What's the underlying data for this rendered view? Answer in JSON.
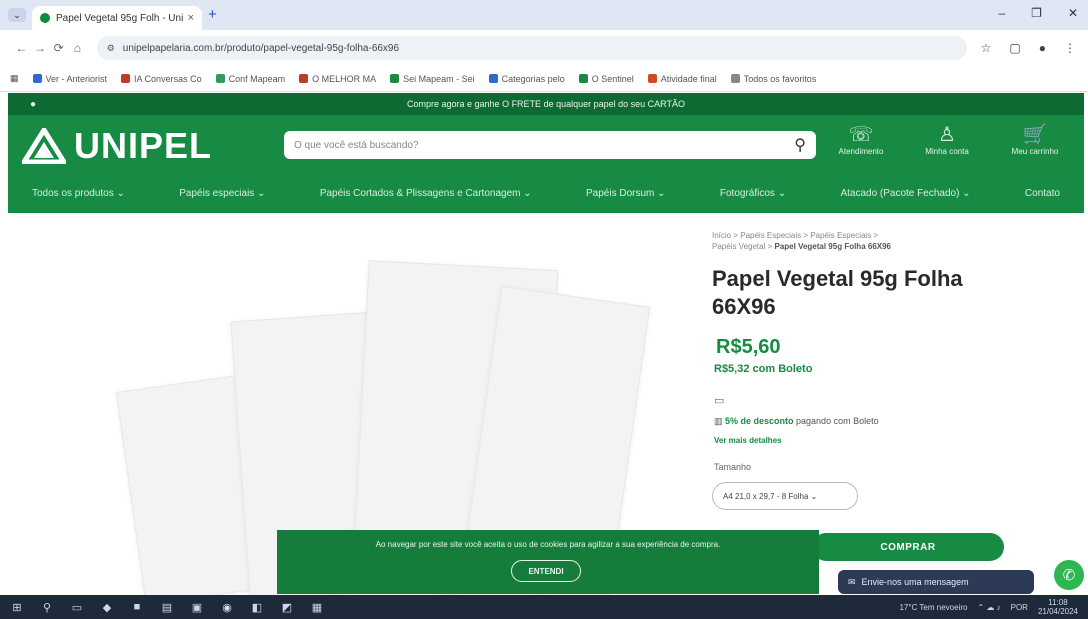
{
  "browser": {
    "tab_title": "Papel Vegetal 95g Folh - Uni",
    "tab_close": "×",
    "new_tab": "+",
    "tab_menu": "⌄",
    "url": "unipelpapelaria.com.br/produto/papel-vegetal-95g-folha-66x96",
    "window_controls": [
      "–",
      "❐",
      "✕"
    ],
    "bookmarks": [
      {
        "label": "Ver - Anteriorist",
        "color": "#2b6ad0"
      },
      {
        "label": "IA Conversas Co",
        "color": "#c0392b"
      },
      {
        "label": "Conf Mapeam",
        "color": "#2e9e5b"
      },
      {
        "label": "O MELHOR MA",
        "color": "#c0392b"
      },
      {
        "label": "Sei Mapeam - Sei",
        "color": "#178a43"
      },
      {
        "label": "Categorias pelo",
        "color": "#2b6ad0"
      },
      {
        "label": "O Sentinel",
        "color": "#178a43"
      },
      {
        "label": "Atividade final",
        "color": "#d04a1e"
      },
      {
        "label": "Todos os favoritos",
        "color": "#888888"
      }
    ]
  },
  "site": {
    "promo": "Compre agora e ganhe O FRETE de qualquer papel do seu CARTÃO",
    "logo": "UNIPEL",
    "search_placeholder": "O que você está buscando?",
    "header_icons": [
      {
        "glyph": "☏",
        "label": "Atendimento"
      },
      {
        "glyph": "♙",
        "label": "Minha conta"
      },
      {
        "glyph": "🛒",
        "label": "Meu carrinho"
      }
    ],
    "menu": [
      "Todos os produtos ⌄",
      "Papéis especiais ⌄",
      "Papéis Cortados & Plissagens e Cartonagem ⌄",
      "Papéis Dorsum ⌄",
      "Fotográficos ⌄",
      "Atacado (Pacote Fechado) ⌄",
      "Contato"
    ]
  },
  "product": {
    "breadcrumb_1": "Início > Papéis Especiais > Papéis Especiais >",
    "breadcrumb_2": "Papéis Vegetal > ",
    "breadcrumb_current": "Papel Vegetal 95g Folha 66X96",
    "title": "Papel Vegetal 95g Folha 66X96",
    "price": "R$5,60",
    "boleto_price": "R$5,32 com Boleto",
    "card_icon": "▭",
    "discount_pct": "5% de desconto",
    "discount_rest": " pagando com Boleto",
    "installments_link": "Ver mais detalhes",
    "size_label": "Tamanho",
    "size_value": "A4 21,0 x 29,7 - 8 Folha ⌄",
    "buy_button": "COMPRAR"
  },
  "cookie": {
    "message": "Ao navegar por este site você aceita o uso de cookies para agilizar a sua experiência de compra.",
    "accept": "ENTENDI"
  },
  "chat": {
    "label": "Envie-nos uma mensagem",
    "icon": "✉"
  },
  "whatsapp_icon": "✆",
  "taskbar": {
    "weather": "17°C Tem nevoeiro",
    "time": "11:08",
    "date": "21/04/2024",
    "lang": "POR"
  }
}
